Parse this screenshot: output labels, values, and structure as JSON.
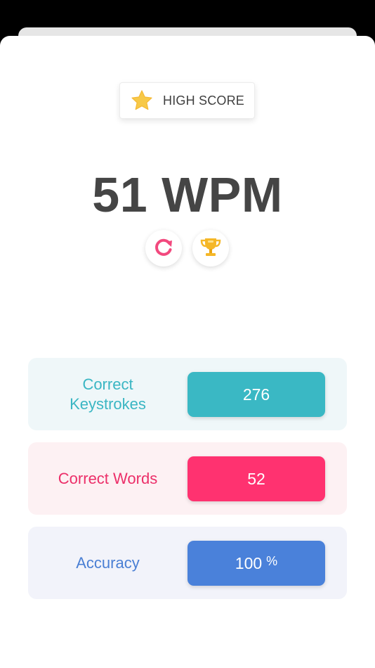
{
  "header": {
    "badge_label": "HIGH SCORE",
    "badge_icon": "star-icon"
  },
  "result": {
    "wpm_text": "51 WPM",
    "actions": [
      {
        "icon": "retry-icon"
      },
      {
        "icon": "trophy-icon"
      }
    ]
  },
  "stats": {
    "keystrokes": {
      "label": "Correct Keystrokes",
      "value": "276"
    },
    "words": {
      "label": "Correct Words",
      "value": "52"
    },
    "accuracy": {
      "label": "Accuracy",
      "value": "100",
      "unit": "%"
    }
  },
  "colors": {
    "keystrokes": "#3ab8c4",
    "words": "#ff3270",
    "accuracy": "#4a81da",
    "star": "#f7c948"
  }
}
